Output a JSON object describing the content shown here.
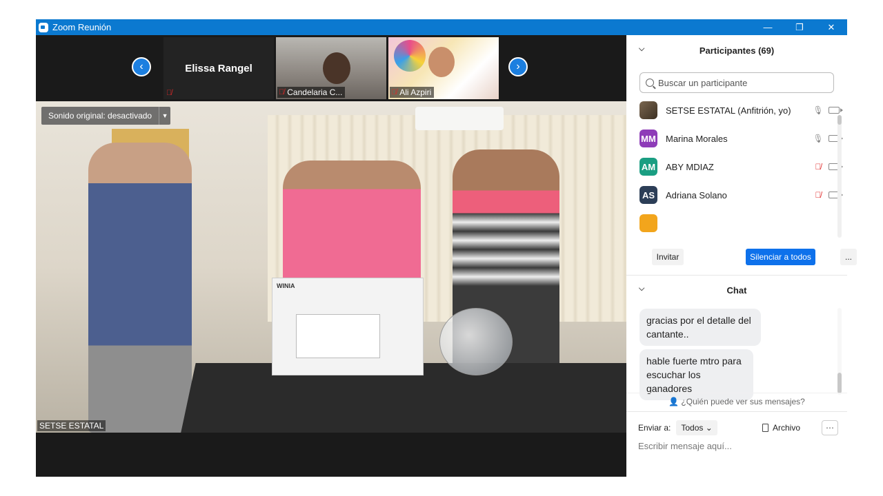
{
  "window": {
    "title": "Zoom Reunión",
    "controls": {
      "minimize": "—",
      "restore": "❐",
      "close": "✕"
    }
  },
  "gallery": {
    "tiles": [
      {
        "name": "Elissa Rangel"
      },
      {
        "name": "Candelaria C..."
      },
      {
        "name": "Ali Azpiri"
      }
    ]
  },
  "main_video": {
    "sound_button": "Sonido original: desactivado",
    "speaker": "SETSE ESTATAL",
    "box_brand": "WINIA"
  },
  "participants": {
    "header": "Participantes (69)",
    "search_placeholder": "Buscar un participante",
    "list": [
      {
        "name": "SETSE ESTATAL (Anfitrión, yo)",
        "initials": "",
        "color": "#6b5a45",
        "muted": false
      },
      {
        "name": "Marina Morales",
        "initials": "MM",
        "color": "#8e3cb8",
        "muted": false
      },
      {
        "name": "ABY MDIAZ",
        "initials": "AM",
        "color": "#1a9e82",
        "muted": true
      },
      {
        "name": "Adriana Solano",
        "initials": "AS",
        "color": "#2c3e57",
        "muted": true
      }
    ],
    "invite": "Invitar",
    "mute_all": "Silenciar a todos",
    "more": "..."
  },
  "chat": {
    "header": "Chat",
    "messages": [
      "gracias por el detalle del cantante..",
      "hable fuerte mtro para escuchar los ganadores"
    ],
    "who_can_see": "¿Quién puede ver sus mensajes?",
    "send_to_label": "Enviar a:",
    "send_to_value": "Todos",
    "file_label": "Archivo",
    "input_placeholder": "Escribir mensaje aquí..."
  }
}
